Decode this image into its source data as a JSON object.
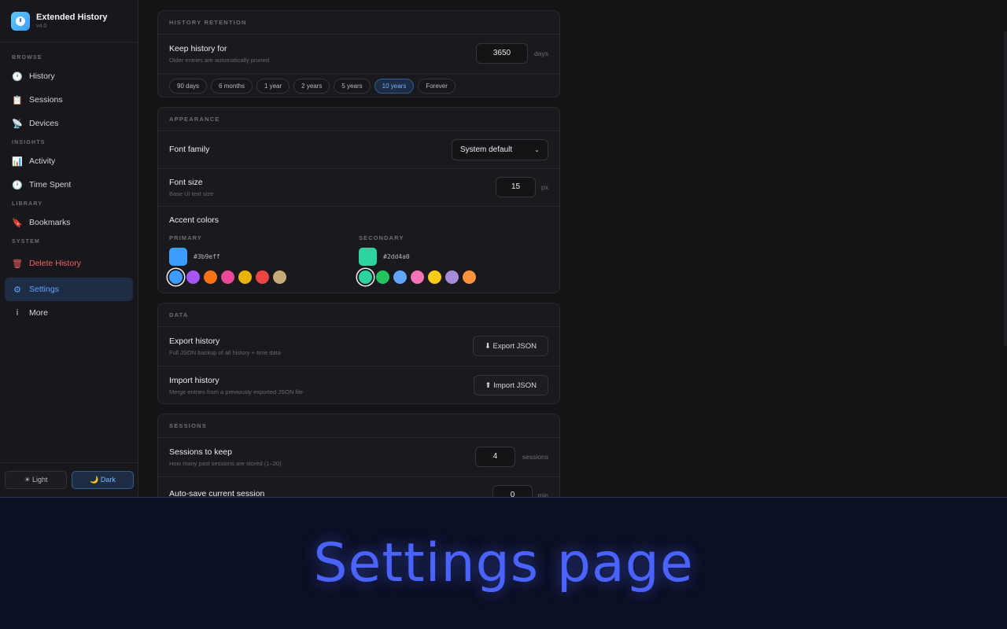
{
  "app": {
    "name": "Extended History",
    "version": "v4.0"
  },
  "sidebar": {
    "sections": {
      "browse": "BROWSE",
      "insights": "INSIGHTS",
      "library": "LIBRARY",
      "system": "SYSTEM"
    },
    "items": {
      "history": {
        "label": "History",
        "icon": "clock-icon",
        "glyph": "🕐"
      },
      "sessions": {
        "label": "Sessions",
        "icon": "clipboard-icon",
        "glyph": "📋"
      },
      "devices": {
        "label": "Devices",
        "icon": "satellite-icon",
        "glyph": "📡"
      },
      "activity": {
        "label": "Activity",
        "icon": "bar-chart-icon",
        "glyph": "📊"
      },
      "time_spent": {
        "label": "Time Spent",
        "icon": "clock-icon",
        "glyph": "🕐"
      },
      "bookmarks": {
        "label": "Bookmarks",
        "icon": "bookmark-icon",
        "glyph": "🔖"
      },
      "delete_history": {
        "label": "Delete History",
        "icon": "trash-icon",
        "glyph": "🗑"
      },
      "settings": {
        "label": "Settings",
        "icon": "gear-icon",
        "glyph": "⚙"
      },
      "more": {
        "label": "More",
        "icon": "info-icon",
        "glyph": "i"
      }
    },
    "theme": {
      "light": "☀ Light",
      "dark": "🌙 Dark",
      "active": "dark"
    }
  },
  "retention": {
    "heading": "HISTORY RETENTION",
    "title": "Keep history for",
    "subtitle": "Older entries are automatically pruned",
    "value": "3650",
    "unit": "days",
    "presets": [
      "90 days",
      "6 months",
      "1 year",
      "2 years",
      "5 years",
      "10 years",
      "Forever"
    ],
    "selected_preset": "10 years"
  },
  "appearance": {
    "heading": "APPEARANCE",
    "font_family": {
      "title": "Font family",
      "value": "System default",
      "chevron": "⌄"
    },
    "font_size": {
      "title": "Font size",
      "subtitle": "Base UI text size",
      "value": "15",
      "unit": "px"
    },
    "accent": {
      "title": "Accent colors",
      "primary": {
        "label": "PRIMARY",
        "hex": "#3b9eff",
        "swatches": [
          "#3b9eff",
          "#a855f7",
          "#f97316",
          "#ec4899",
          "#eab308",
          "#ef4444",
          "#c8a97a"
        ]
      },
      "secondary": {
        "label": "SECONDARY",
        "hex": "#2dd4a0",
        "swatches": [
          "#2dd4a0",
          "#22c55e",
          "#60a5fa",
          "#f472b6",
          "#facc15",
          "#a78bdb",
          "#fb923c"
        ]
      }
    }
  },
  "data_section": {
    "heading": "DATA",
    "export": {
      "title": "Export history",
      "subtitle": "Full JSON backup of all history + time data",
      "button": "⬇ Export JSON"
    },
    "import": {
      "title": "Import history",
      "subtitle": "Merge entries from a previously exported JSON file",
      "button": "⬆ Import JSON"
    }
  },
  "sessions_section": {
    "heading": "SESSIONS",
    "keep": {
      "title": "Sessions to keep",
      "subtitle": "How many past sessions are stored (1–20)",
      "value": "4",
      "unit": "sessions"
    },
    "autosave": {
      "title": "Auto-save current session",
      "value": "0",
      "unit": "min"
    }
  },
  "caption": "Settings page"
}
